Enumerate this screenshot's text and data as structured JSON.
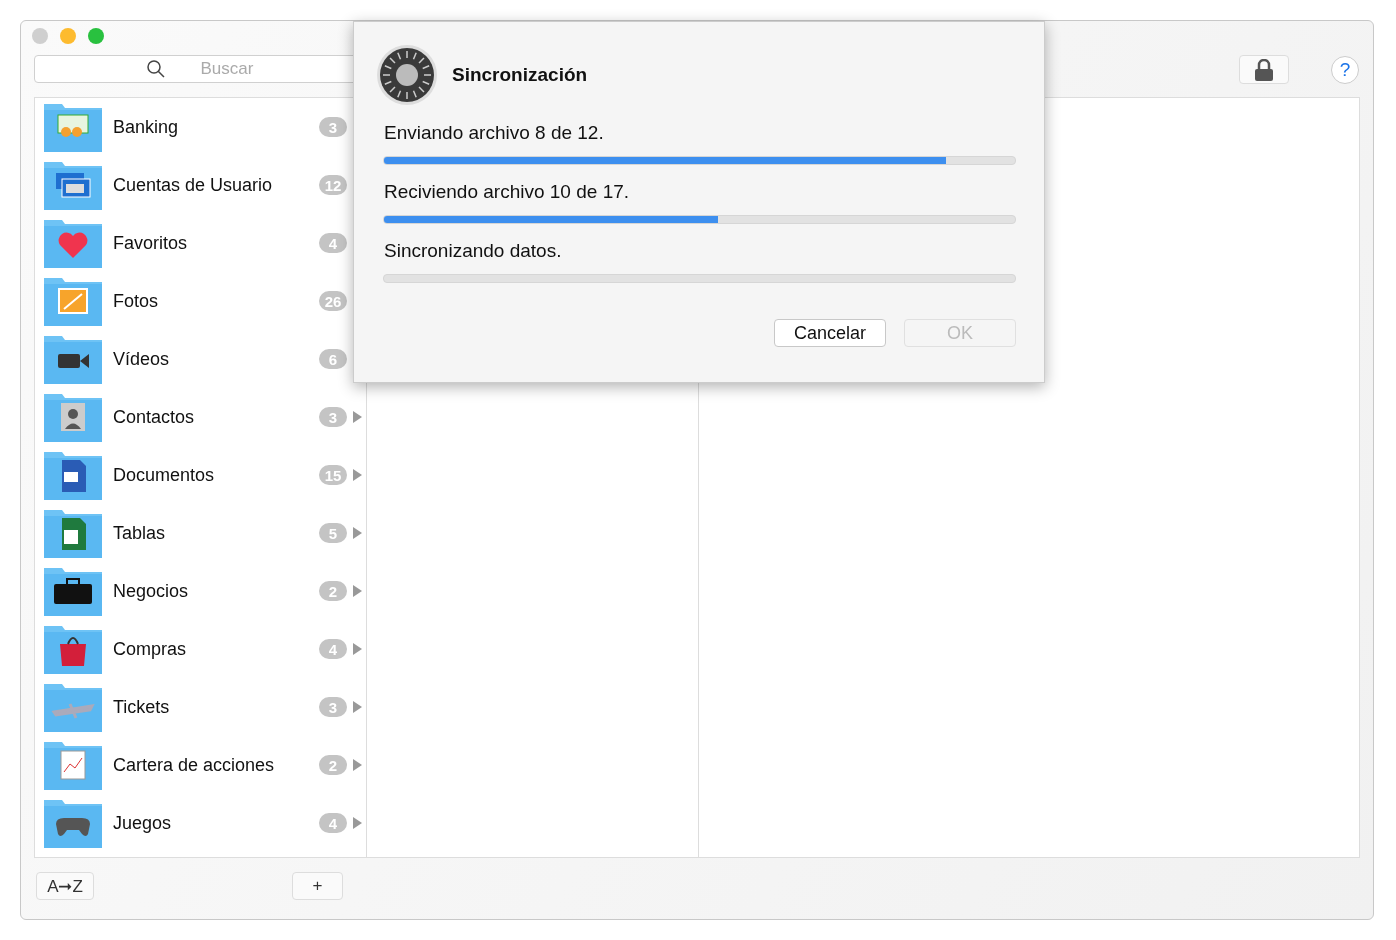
{
  "window": {
    "search": {
      "placeholder": "Buscar"
    },
    "help_button": "?"
  },
  "sidebar": {
    "items": [
      {
        "label": "Banking",
        "count": "3",
        "expandable": false
      },
      {
        "label": "Cuentas de Usuario",
        "count": "12",
        "expandable": false
      },
      {
        "label": "Favoritos",
        "count": "4",
        "expandable": false
      },
      {
        "label": "Fotos",
        "count": "26",
        "expandable": false
      },
      {
        "label": "Vídeos",
        "count": "6",
        "expandable": false
      },
      {
        "label": "Contactos",
        "count": "3",
        "expandable": true
      },
      {
        "label": "Documentos",
        "count": "15",
        "expandable": true
      },
      {
        "label": "Tablas",
        "count": "5",
        "expandable": true
      },
      {
        "label": "Negocios",
        "count": "2",
        "expandable": true
      },
      {
        "label": "Compras",
        "count": "4",
        "expandable": true
      },
      {
        "label": "Tickets",
        "count": "3",
        "expandable": true
      },
      {
        "label": "Cartera de acciones",
        "count": "2",
        "expandable": true
      },
      {
        "label": "Juegos",
        "count": "4",
        "expandable": true
      }
    ]
  },
  "bottom_bar": {
    "sort_button": "A➞Z",
    "add_button": "+"
  },
  "dialog": {
    "title": "Sincronización",
    "progress": [
      {
        "label": "Enviando archivo 8 de 12.",
        "level": 0.89
      },
      {
        "label": "Reciviendo archivo 10 de 17.",
        "level": 0.53
      },
      {
        "label": "Sincronizando datos.",
        "level": 0
      }
    ],
    "buttons": [
      {
        "label": "Cancelar",
        "disabled": false
      },
      {
        "label": "OK",
        "disabled": true
      }
    ]
  }
}
